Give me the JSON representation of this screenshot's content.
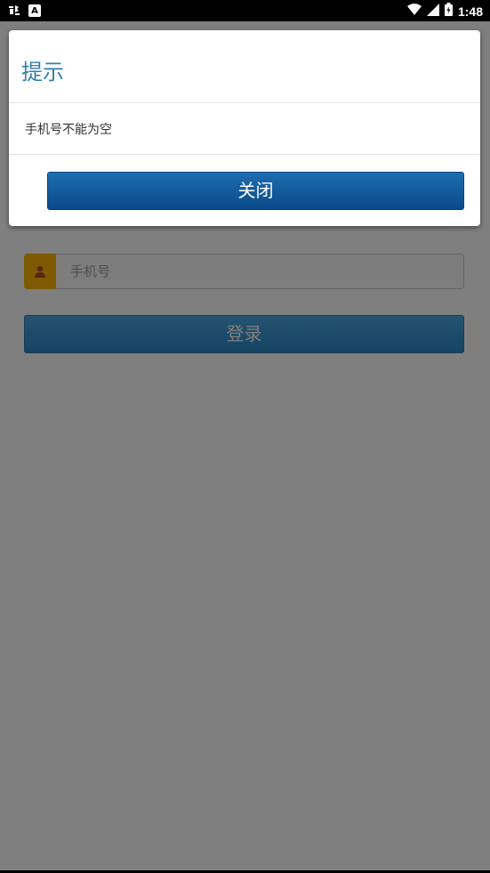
{
  "status_bar": {
    "time": "1:48",
    "left_icons": [
      "app-notification-icon",
      "a-letter-icon"
    ],
    "right_icons": [
      "wifi-icon",
      "signal-icon",
      "battery-icon"
    ],
    "a_icon_label": "A"
  },
  "login_form": {
    "phone_placeholder": "手机号",
    "phone_value": "",
    "login_label": "登录",
    "user_icon_color": "#ffb400",
    "login_color": "#2b86c6"
  },
  "dialog": {
    "title": "提示",
    "message": "手机号不能为空",
    "close_label": "关闭",
    "title_color": "#2f7fb0",
    "close_color": "#0a4a8a"
  }
}
